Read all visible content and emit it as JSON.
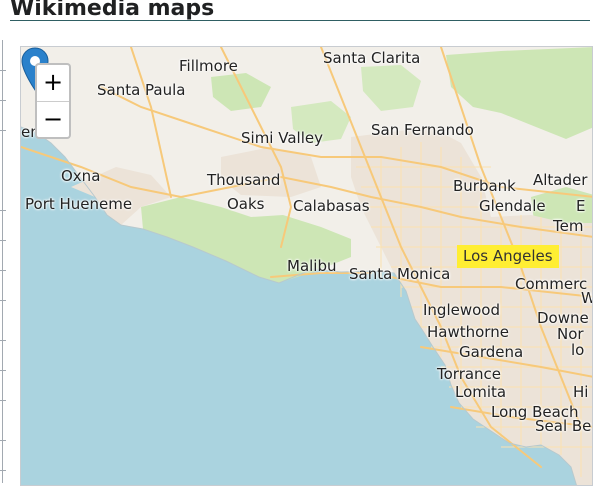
{
  "section": {
    "title": "Wikimedia maps"
  },
  "zoom": {
    "in_label": "+",
    "out_label": "−"
  },
  "colors": {
    "ocean": "#aad3df",
    "land": "#f2efe9",
    "park": "#cde6b5",
    "urban": "#ece3d8",
    "road": "#f7c97a",
    "highlight": "#ffee33",
    "marker": "#2a81cb"
  },
  "marker": {
    "icon": "map-pin-icon",
    "color": "#2a81cb"
  },
  "places": [
    {
      "id": "santa-clarita",
      "label": "Santa Clarita"
    },
    {
      "id": "fillmore",
      "label": "Fillmore"
    },
    {
      "id": "santa-paula",
      "label": "Santa Paula"
    },
    {
      "id": "simi-valley",
      "label": "Simi Valley"
    },
    {
      "id": "san-fernando",
      "label": "San Fernando"
    },
    {
      "id": "ventura",
      "label": "entura"
    },
    {
      "id": "oxnard",
      "label": "Oxna"
    },
    {
      "id": "port-hueneme",
      "label": "Port Hueneme"
    },
    {
      "id": "thousand-oaks-1",
      "label": "Thousand"
    },
    {
      "id": "thousand-oaks-2",
      "label": "Oaks"
    },
    {
      "id": "calabasas",
      "label": "Calabasas"
    },
    {
      "id": "burbank",
      "label": "Burbank"
    },
    {
      "id": "altadena",
      "label": "Altader"
    },
    {
      "id": "glendale",
      "label": "Glendale"
    },
    {
      "id": "el-monte",
      "label": "E"
    },
    {
      "id": "temple-city",
      "label": "Tem"
    },
    {
      "id": "malibu",
      "label": "Malibu"
    },
    {
      "id": "santa-monica",
      "label": "Santa Monica"
    },
    {
      "id": "los-angeles",
      "label": "Los Angeles",
      "highlight": true
    },
    {
      "id": "commerce",
      "label": "Commerc"
    },
    {
      "id": "whittier",
      "label": "W"
    },
    {
      "id": "inglewood",
      "label": "Inglewood"
    },
    {
      "id": "downey",
      "label": "Downe"
    },
    {
      "id": "hawthorne",
      "label": "Hawthorne"
    },
    {
      "id": "norwalk",
      "label": "Nor"
    },
    {
      "id": "gardena",
      "label": "Gardena"
    },
    {
      "id": "lowland",
      "label": "lo"
    },
    {
      "id": "torrance",
      "label": "Torrance"
    },
    {
      "id": "lomita",
      "label": "Lomita"
    },
    {
      "id": "hi",
      "label": "Hi"
    },
    {
      "id": "long-beach",
      "label": "Long Beach"
    },
    {
      "id": "seal-beach",
      "label": "Seal Be"
    }
  ]
}
